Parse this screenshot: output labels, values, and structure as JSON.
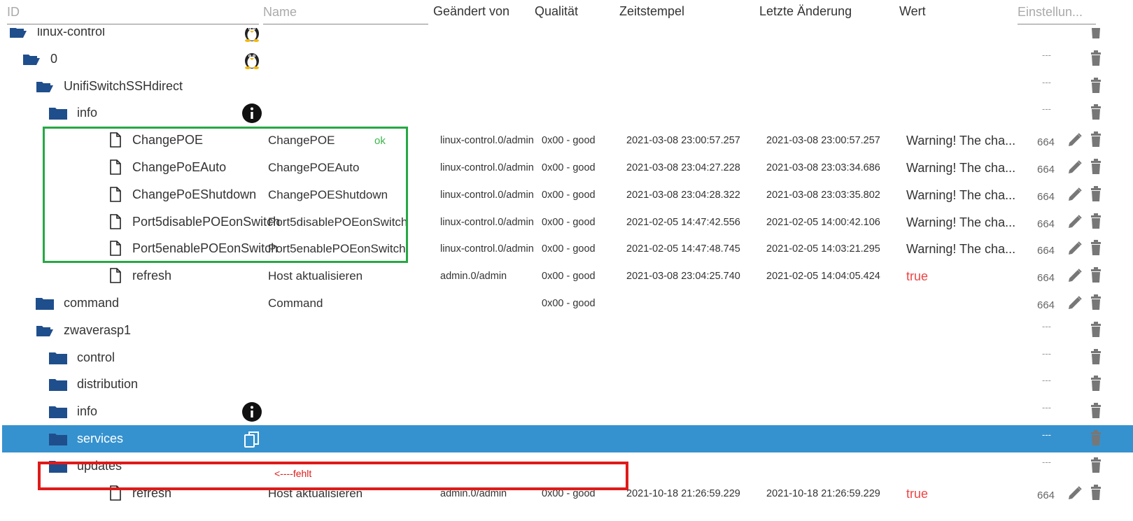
{
  "header": {
    "id_placeholder": "ID",
    "name_placeholder": "Name",
    "changed_by": "Geändert von",
    "quality": "Qualität",
    "timestamp": "Zeitstempel",
    "last_change": "Letzte Änderung",
    "value": "Wert",
    "settings_placeholder": "Einstellun..."
  },
  "rows": [
    {
      "id": "linux-control",
      "type": "folder-open",
      "level": 0,
      "icon": "tux-icon"
    },
    {
      "id": "0",
      "type": "folder-open",
      "level": 1,
      "icon": "tux-icon",
      "dash": "---"
    },
    {
      "id": "UnifiSwitchSSHdirect",
      "type": "folder-open",
      "level": 2,
      "dash": "---"
    },
    {
      "id": "info",
      "type": "folder",
      "level": 3,
      "icon": "info-icon",
      "dash": "---"
    },
    {
      "id": "ChangePOE",
      "type": "file",
      "level": 4,
      "name": "ChangePOE",
      "ok": "ok",
      "changed_by": "linux-control.0/admin",
      "quality": "0x00 - good",
      "timestamp": "2021-03-08 23:00:57.257",
      "last_change": "2021-03-08 23:00:57.257",
      "value": "Warning! The cha...",
      "num": "664"
    },
    {
      "id": "ChangePoEAuto",
      "type": "file",
      "level": 4,
      "name": "ChangePOEAuto",
      "changed_by": "linux-control.0/admin",
      "quality": "0x00 - good",
      "timestamp": "2021-03-08 23:04:27.228",
      "last_change": "2021-03-08 23:03:34.686",
      "value": "Warning! The cha...",
      "num": "664"
    },
    {
      "id": "ChangePoEShutdown",
      "type": "file",
      "level": 4,
      "name": "ChangePOEShutdown",
      "changed_by": "linux-control.0/admin",
      "quality": "0x00 - good",
      "timestamp": "2021-03-08 23:04:28.322",
      "last_change": "2021-03-08 23:03:35.802",
      "value": "Warning! The cha...",
      "num": "664"
    },
    {
      "id": "Port5disablePOEonSwitch",
      "type": "file",
      "level": 4,
      "name": "Port5disablePOEonSwitch",
      "changed_by": "linux-control.0/admin",
      "quality": "0x00 - good",
      "timestamp": "2021-02-05 14:47:42.556",
      "last_change": "2021-02-05 14:00:42.106",
      "value": "Warning! The cha...",
      "num": "664"
    },
    {
      "id": "Port5enablePOEonSwitch",
      "type": "file",
      "level": 4,
      "name": "Port5enablePOEonSwitch",
      "changed_by": "linux-control.0/admin",
      "quality": "0x00 - good",
      "timestamp": "2021-02-05 14:47:48.745",
      "last_change": "2021-02-05 14:03:21.295",
      "value": "Warning! The cha...",
      "num": "664"
    },
    {
      "id": "refresh",
      "type": "file",
      "level": 4,
      "name": "Host aktualisieren",
      "changed_by": "admin.0/admin",
      "quality": "0x00 - good",
      "timestamp": "2021-03-08 23:04:25.740",
      "last_change": "2021-02-05 14:04:05.424",
      "value": "true",
      "value_true": true,
      "num": "664"
    },
    {
      "id": "command",
      "type": "folder",
      "level": 2,
      "name": "Command",
      "quality": "0x00 - good",
      "num": "664"
    },
    {
      "id": "zwaverasp1",
      "type": "folder-open",
      "level": 2,
      "dash": "---"
    },
    {
      "id": "control",
      "type": "folder",
      "level": 3,
      "dash": "---"
    },
    {
      "id": "distribution",
      "type": "folder",
      "level": 3,
      "dash": "---"
    },
    {
      "id": "info",
      "type": "folder",
      "level": 3,
      "icon": "info-icon",
      "dash": "---"
    },
    {
      "id": "services",
      "type": "folder",
      "level": 3,
      "icon": "copy-icon",
      "dash": "---",
      "selected": true
    },
    {
      "id": "updates",
      "type": "folder",
      "level": 3,
      "dash": "---"
    },
    {
      "id": "refresh",
      "type": "file",
      "level": 4,
      "name": "Host aktualisieren",
      "changed_by": "admin.0/admin",
      "quality": "0x00 - good",
      "timestamp": "2021-10-18 21:26:59.229",
      "last_change": "2021-10-18 21:26:59.229",
      "value": "true",
      "value_true": true,
      "num": "664"
    }
  ],
  "annotation": {
    "missing_label": "<----fehlt"
  },
  "colors": {
    "folder": "#1f4e8c",
    "selected": "#3592cf",
    "ok": "#3bb54a",
    "true": "#ee4444",
    "green_frame": "#27a844",
    "red_frame": "#e01a1a"
  }
}
